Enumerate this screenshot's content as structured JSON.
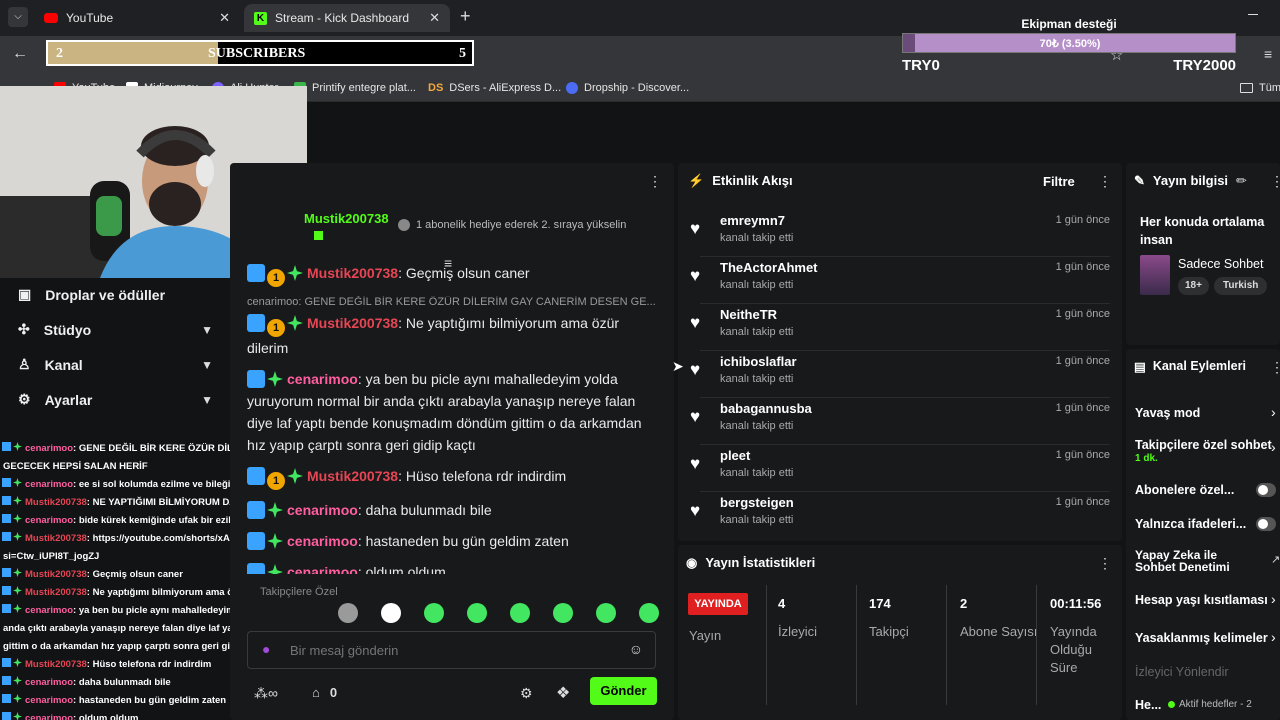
{
  "browser": {
    "tabs": [
      {
        "title": "YouTube",
        "icon": "youtube-icon",
        "color": "#ff0000"
      },
      {
        "title": "Stream - Kick Dashboard",
        "icon": "kick-icon",
        "color": "#53fc18"
      }
    ],
    "new_tab": "+",
    "bookmarks": [
      {
        "label": "YouTube"
      },
      {
        "label": "Midjourney"
      },
      {
        "label": "Ali Hunter"
      },
      {
        "label": "Printify entegre plat..."
      },
      {
        "label": "DSers - AliExpress D..."
      },
      {
        "label": "Dropship - Discover..."
      }
    ],
    "bookmarks_right": "Tüm"
  },
  "subscriber_goal": {
    "current": "2",
    "label": "SUBSCRIBERS",
    "target": "5",
    "progress": 0.4
  },
  "donation_goal": {
    "title": "Ekipman desteği",
    "amount": "70₺ (3.50%)",
    "progress": 0.035,
    "min": "TRY0",
    "max": "TRY2000"
  },
  "nav": {
    "items": [
      {
        "label": "Droplar ve ödüller",
        "icon": "gift-icon"
      },
      {
        "label": "Stüdyo",
        "icon": "studio-icon"
      },
      {
        "label": "Kanal",
        "icon": "channel-icon"
      },
      {
        "label": "Ayarlar",
        "icon": "gear-icon"
      }
    ]
  },
  "obs_chat": [
    {
      "user": "cenarimoo",
      "text": ": GENE DEĞİL BİR KERE ÖZÜR DİLERİM GAY CANERİM DESEN",
      "cont": "GECECEK HEPSİ SALAN HERİF"
    },
    {
      "user": "cenarimoo",
      "text": ": ee si sol kolumda ezilme ve bileğinde de kırık var"
    },
    {
      "user": "Mustik200738",
      "text": ": NE YAPTIĞIMI BİLMİYORUM DAHA"
    },
    {
      "user": "cenarimoo",
      "text": ": bide kürek kemiğinde ufak bir ezilme var"
    },
    {
      "user": "Mustik200738",
      "text": ": https://youtube.com/shorts/xAuO-pXQKYM?",
      "cont": "si=Ctw_iUPI8T_jogZJ"
    },
    {
      "user": "Mustik200738",
      "text": ": Geçmiş olsun caner"
    },
    {
      "user": "Mustik200738",
      "text": ": Ne yaptığımı bilmiyorum ama özür dilerim"
    },
    {
      "user": "cenarimoo",
      "text": ": ya ben bu picle aynı mahalledeyim yolda yuruyorum normal bir",
      "cont": "anda çıktı arabayla yanaşıp nereye falan diye laf yaptı bende konuşmadım döndüm",
      "cont2": "gittim o da arkamdan hız yapıp çarptı sonra geri gidip kaçtı"
    },
    {
      "user": "Mustik200738",
      "text": ": Hüso telefona rdr indirdim"
    },
    {
      "user": "cenarimoo",
      "text": ": daha bulunmadı bile"
    },
    {
      "user": "cenarimoo",
      "text": ": hastaneden bu gün geldim zaten"
    },
    {
      "user": "cenarimoo",
      "text": ": oldum oldum"
    }
  ],
  "chat": {
    "pinned_user": "Mustik200738",
    "gift_notice": "1 abonelik hediye ederek 2. sıraya yükselin",
    "messages": [
      {
        "user": "Mustik200738",
        "text": ": Geçmiş olsun caner"
      },
      {
        "reply": "cenarimoo: GENE DEĞİL BİR KERE ÖZÜR DİLERİM GAY CANERİM DESEN GE..."
      },
      {
        "user": "Mustik200738",
        "text": ": Ne yaptığımı bilmiyorum ama özür dilerim"
      },
      {
        "user": "cenarimoo",
        "text": ": ya ben bu picle aynı mahalledeyim yolda yuruyorum normal bir anda çıktı arabayla yanaşıp nereye falan diye laf yaptı bende konuşmadım döndüm gittim o da arkamdan hız yapıp çarptı sonra geri gidip kaçtı"
      },
      {
        "user": "Mustik200738",
        "text": ": Hüso telefona rdr indirdim"
      },
      {
        "user": "cenarimoo",
        "text": ": daha bulunmadı bile"
      },
      {
        "user": "cenarimoo",
        "text": ": hastaneden bu gün geldim zaten"
      },
      {
        "user": "cenarimoo",
        "text": ": oldum oldum"
      }
    ],
    "emote_section": "Takipçilere Özel",
    "placeholder": "Bir mesaj gönderin",
    "points": "0",
    "send": "Gönder"
  },
  "activity": {
    "title": "Etkinlik Akışı",
    "filter": "Filtre",
    "items": [
      {
        "name": "emreymn7",
        "sub": "kanalı takip etti",
        "time": "1 gün önce"
      },
      {
        "name": "TheActorAhmet",
        "sub": "kanalı takip etti",
        "time": "1 gün önce"
      },
      {
        "name": "NeitheTR",
        "sub": "kanalı takip etti",
        "time": "1 gün önce"
      },
      {
        "name": "ichiboslaflar",
        "sub": "kanalı takip etti",
        "time": "1 gün önce"
      },
      {
        "name": "babagannusba",
        "sub": "kanalı takip etti",
        "time": "1 gün önce"
      },
      {
        "name": "pleet",
        "sub": "kanalı takip etti",
        "time": "1 gün önce"
      },
      {
        "name": "bergsteigen",
        "sub": "kanalı takip etti",
        "time": "1 gün önce"
      }
    ]
  },
  "stats": {
    "title": "Yayın İstatistikleri",
    "live_badge": "YAYINDA",
    "stream_label": "Yayın",
    "items": [
      {
        "value": "4",
        "label": "İzleyici"
      },
      {
        "value": "174",
        "label": "Takipçi"
      },
      {
        "value": "2",
        "label": "Abone Sayısı"
      },
      {
        "value": "00:11:56",
        "label": "Yayında Olduğu Süre"
      }
    ]
  },
  "stream_info": {
    "title": "Yayın bilgisi",
    "stream_title": "Her konuda ortalama insan",
    "category": "Sadece Sohbet",
    "tags": [
      "18+",
      "Turkish"
    ]
  },
  "channel_actions": {
    "title": "Kanal Eylemleri",
    "items": [
      {
        "label": "Yavaş mod"
      },
      {
        "label": "Takipçilere özel sohbet",
        "sub": "1 dk."
      },
      {
        "label": "Abonelere özel..."
      },
      {
        "label": "Yalnızca ifadeleri..."
      },
      {
        "label": "Yapay Zeka ile Sohbet Denetimi"
      },
      {
        "label": "Hesap yaşı kısıtlaması"
      },
      {
        "label": "Yasaklanmış kelimeler"
      },
      {
        "label": "İzleyici Yönlendir"
      },
      {
        "label": "He...",
        "sub": "Aktif hedefler - 2"
      }
    ]
  },
  "colors": {
    "kick_green": "#53fc18",
    "live_red": "#e02020",
    "username_pink": "#ff5fa0",
    "username_red": "#e64553"
  }
}
